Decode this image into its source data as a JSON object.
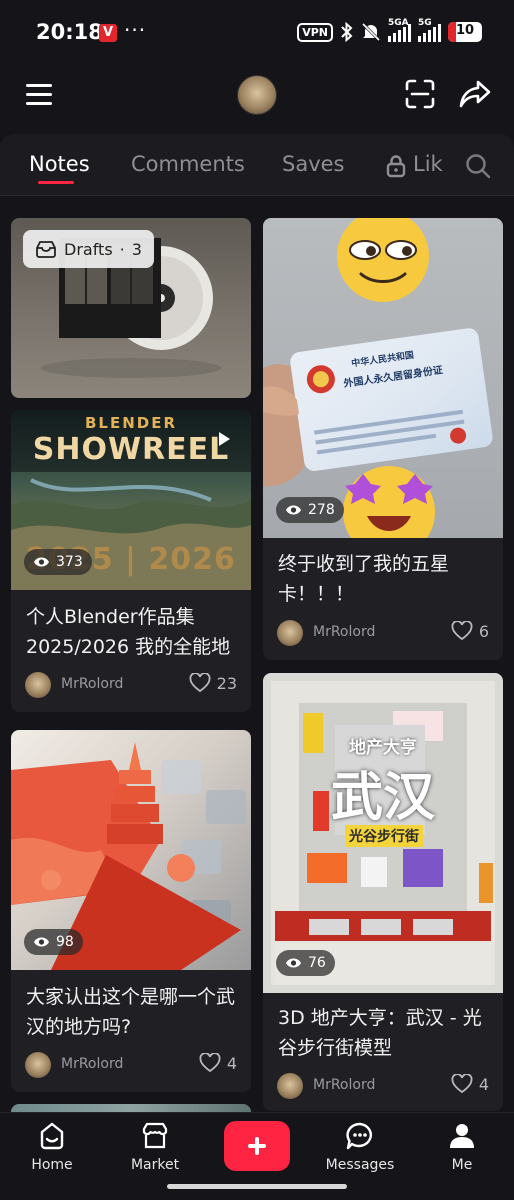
{
  "status": {
    "time": "20:18",
    "vpn": "VPN",
    "sig1": "5GA",
    "sig2": "5G",
    "battery": "10"
  },
  "tabs": [
    "Notes",
    "Comments",
    "Saves",
    "Lik"
  ],
  "drafts": {
    "label": "Drafts",
    "sep": "·",
    "count": "3"
  },
  "cards": [
    {
      "title": "个人Blender作品集2025/2026 我的全能地",
      "author": "MrRolord",
      "likes": "23",
      "views": "373",
      "thumb_text": {
        "line1": "BLENDER",
        "line2": "SHOWREEL",
        "year": "2025 | 2026"
      }
    },
    {
      "title": "大家认出这个是哪一个武汉的地方吗?",
      "author": "MrRolord",
      "likes": "4",
      "views": "98"
    },
    {
      "title": "终于收到了我的五星卡！！！",
      "author": "MrRolord",
      "likes": "6",
      "views": "278",
      "thumb_text": {
        "card_l1": "中华人民共和国",
        "card_l2": "外国人永久居留身份证"
      }
    },
    {
      "title": "3D 地产大亨：武汉 - 光谷步行街模型",
      "author": "MrRolord",
      "likes": "4",
      "views": "76",
      "thumb_text": {
        "top": "地产大亨",
        "big": "武汉",
        "sub": "光谷步行街"
      }
    }
  ],
  "nav": {
    "home": "Home",
    "market": "Market",
    "messages": "Messages",
    "me": "Me"
  },
  "colors": {
    "accent": "#ff2442",
    "bg": "#151519",
    "card": "#1f1f24"
  }
}
